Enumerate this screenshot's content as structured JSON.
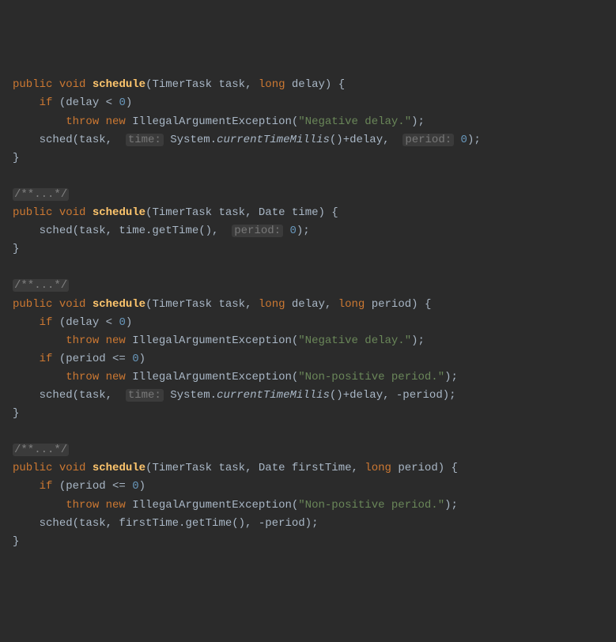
{
  "methods": [
    {
      "sig": {
        "p1": "public",
        "p2": "void",
        "name": "schedule",
        "params": "(TimerTask task, ",
        "kw2": "long",
        "rest": " delay) {"
      },
      "body": [
        {
          "indent": "    ",
          "pre": "",
          "kw": "if",
          "post": " (delay < ",
          "num": "0",
          "tail": ")"
        },
        {
          "indent": "        ",
          "pre": "",
          "kw": "throw new",
          "post": " IllegalArgumentException(",
          "str": "\"Negative delay.\"",
          "tail": ");"
        },
        {
          "indent": "    ",
          "pre": "sched(task,  ",
          "hint1": "time:",
          "mid1": " System.",
          "italic": "currentTimeMillis",
          "mid2": "()+delay,  ",
          "hint2": "period:",
          "post": " ",
          "num": "0",
          "tail": ");"
        }
      ],
      "close": "}"
    },
    {
      "fold": "/**...*/",
      "sig": {
        "p1": "public",
        "p2": "void",
        "name": "schedule",
        "params": "(TimerTask task, Date time) {"
      },
      "body": [
        {
          "indent": "    ",
          "pre": "sched(task, time.getTime(),  ",
          "hint1": "period:",
          "post": " ",
          "num": "0",
          "tail": ");"
        }
      ],
      "close": "}"
    },
    {
      "fold": "/**...*/",
      "sig": {
        "p1": "public",
        "p2": "void",
        "name": "schedule",
        "params": "(TimerTask task, ",
        "kw2": "long",
        "mid": " delay, ",
        "kw3": "long",
        "rest": " period) {"
      },
      "body": [
        {
          "indent": "    ",
          "pre": "",
          "kw": "if",
          "post": " (delay < ",
          "num": "0",
          "tail": ")"
        },
        {
          "indent": "        ",
          "pre": "",
          "kw": "throw new",
          "post": " IllegalArgumentException(",
          "str": "\"Negative delay.\"",
          "tail": ");"
        },
        {
          "indent": "    ",
          "pre": "",
          "kw": "if",
          "post": " (period <= ",
          "num": "0",
          "tail": ")"
        },
        {
          "indent": "        ",
          "pre": "",
          "kw": "throw new",
          "post": " IllegalArgumentException(",
          "str": "\"Non-positive period.\"",
          "tail": ");"
        },
        {
          "indent": "    ",
          "pre": "sched(task,  ",
          "hint1": "time:",
          "mid1": " System.",
          "italic": "currentTimeMillis",
          "mid2": "()+delay, -period);"
        }
      ],
      "close": "}"
    },
    {
      "fold": "/**...*/",
      "sig": {
        "p1": "public",
        "p2": "void",
        "name": "schedule",
        "params": "(TimerTask task, Date firstTime, ",
        "kw2": "long",
        "rest": " period) {"
      },
      "body": [
        {
          "indent": "    ",
          "pre": "",
          "kw": "if",
          "post": " (period <= ",
          "num": "0",
          "tail": ")"
        },
        {
          "indent": "        ",
          "pre": "",
          "kw": "throw new",
          "post": " IllegalArgumentException(",
          "str": "\"Non-positive period.\"",
          "tail": ");"
        },
        {
          "indent": "    ",
          "pre": "sched(task, firstTime.getTime(), -period);"
        }
      ],
      "close": "}"
    }
  ]
}
